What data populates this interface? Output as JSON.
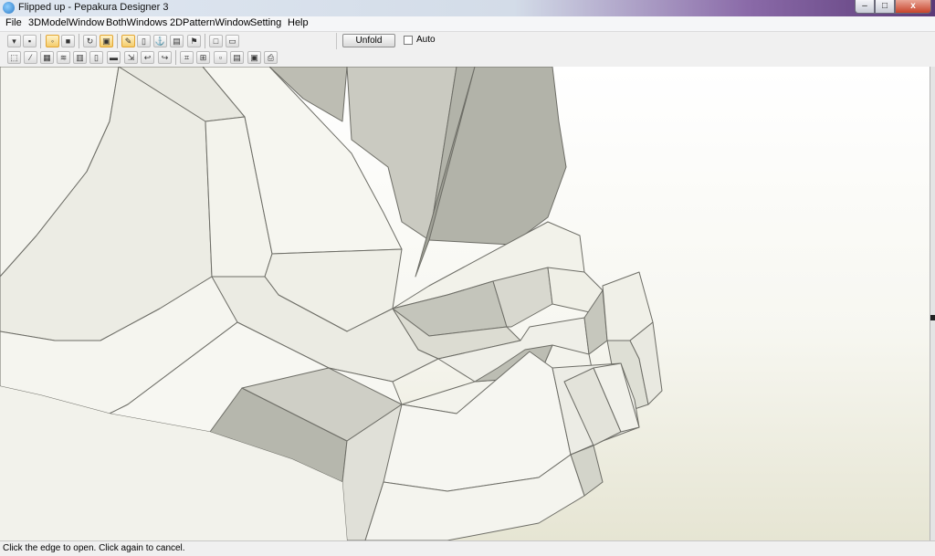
{
  "window": {
    "title": "Flipped up - Pepakura Designer 3",
    "minimize": "–",
    "maximize": "□",
    "close": "x"
  },
  "menu": [
    "File",
    "3DModelWindow",
    "BothWindows",
    "2DPatternWindow",
    "Setting",
    "Help"
  ],
  "toolbar": {
    "unfold_label": "Unfold",
    "auto_label": "Auto",
    "auto_checked": false,
    "row1_icons": [
      "open-folder-icon",
      "save-icon",
      "light-bulb-icon",
      "texture-cube-icon",
      "rotate-model-icon",
      "view-select-icon",
      "draw-edge-icon",
      "cylinder-icon",
      "anchor-icon",
      "paper-icon",
      "flag-icon",
      "single-window-icon",
      "both-windows-icon"
    ],
    "row2_icons": [
      "select-icon",
      "wand-icon",
      "grid-icon",
      "stack-icon",
      "align-icon",
      "page-icon",
      "pattern-icon",
      "move-icon",
      "undo-arrow-icon",
      "redo-arrow-icon",
      "join-icon",
      "fit-icon",
      "piece-icon",
      "pt-icon",
      "page-layout-icon",
      "print-icon",
      "printer-icon"
    ]
  },
  "status": {
    "text": "Click the edge to open. Click again to cancel."
  },
  "colors": {
    "paper_face": "#f5f5ef",
    "paper_shade": "#d7d7cd",
    "paper_dark": "#a7a89e",
    "edge": "#6d6d66"
  }
}
